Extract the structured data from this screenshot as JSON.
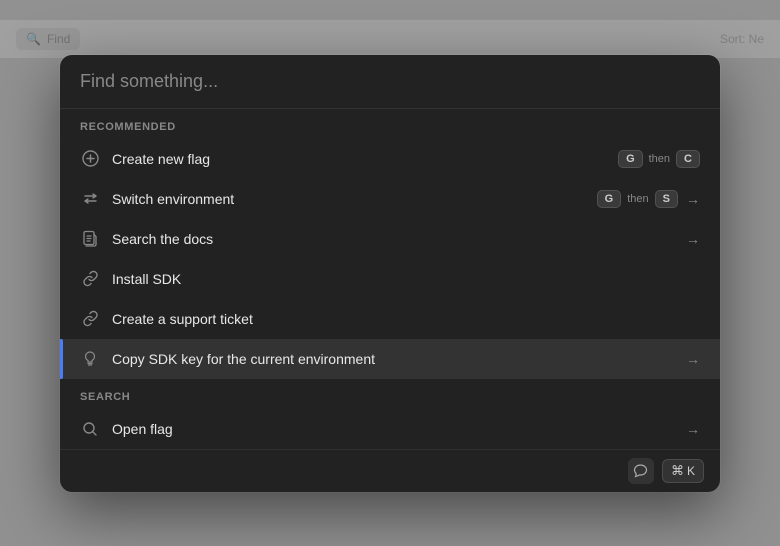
{
  "background": {
    "search_label": "Find",
    "sort_label": "Sort: Ne"
  },
  "palette": {
    "search_placeholder": "Find something...",
    "sections": [
      {
        "id": "recommended",
        "label": "Recommended",
        "items": [
          {
            "id": "create-new-flag",
            "label": "Create new flag",
            "icon": "plus-circle",
            "shortcut": {
              "keys": [
                "G",
                "C"
              ],
              "has_then": true
            },
            "arrow": false,
            "highlighted": false
          },
          {
            "id": "switch-environment",
            "label": "Switch environment",
            "icon": "switch",
            "shortcut": {
              "keys": [
                "G",
                "S"
              ],
              "has_then": true
            },
            "arrow": true,
            "highlighted": false
          },
          {
            "id": "search-docs",
            "label": "Search the docs",
            "icon": "document",
            "shortcut": null,
            "arrow": true,
            "highlighted": false
          },
          {
            "id": "install-sdk",
            "label": "Install SDK",
            "icon": "link",
            "shortcut": null,
            "arrow": false,
            "highlighted": false
          },
          {
            "id": "create-support-ticket",
            "label": "Create a support ticket",
            "icon": "link",
            "shortcut": null,
            "arrow": false,
            "highlighted": false
          },
          {
            "id": "copy-sdk-key",
            "label": "Copy SDK key for the current environment",
            "icon": "bulb",
            "shortcut": null,
            "arrow": true,
            "highlighted": true
          }
        ]
      },
      {
        "id": "search",
        "label": "Search",
        "items": [
          {
            "id": "open-flag",
            "label": "Open flag",
            "icon": "search",
            "shortcut": null,
            "arrow": true,
            "highlighted": false
          }
        ]
      }
    ],
    "footer": {
      "cmd_k": "⌘K"
    }
  }
}
